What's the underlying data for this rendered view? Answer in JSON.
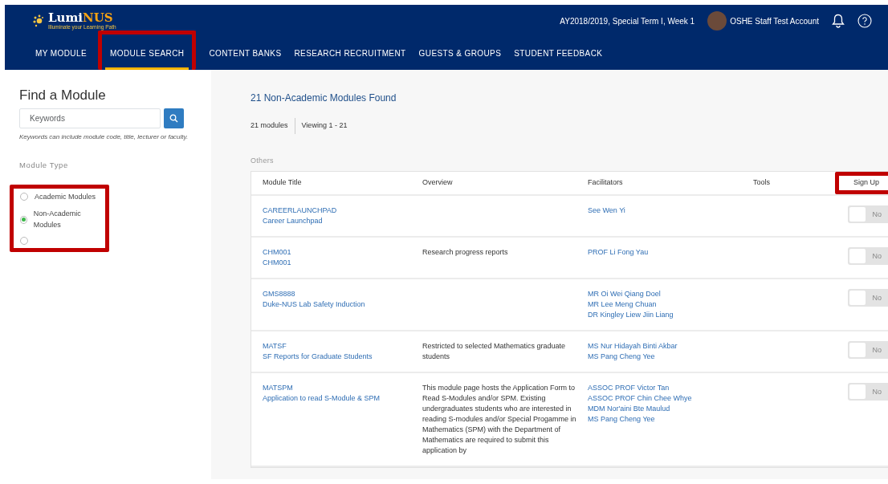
{
  "header": {
    "logo": "LumiNUS",
    "logo_tagline": "Illuminate your Learning Path",
    "term": "AY2018/2019, Special Term I, Week 1",
    "user": "OSHE Staff Test Account"
  },
  "nav": [
    {
      "label": "MY MODULE",
      "selected": false,
      "highlighted": false
    },
    {
      "label": "MODULE SEARCH",
      "selected": true,
      "highlighted": true
    },
    {
      "label": "CONTENT BANKS",
      "selected": false,
      "highlighted": false
    },
    {
      "label": "RESEARCH RECRUITMENT",
      "selected": false,
      "highlighted": false
    },
    {
      "label": "GUESTS & GROUPS",
      "selected": false,
      "highlighted": false
    },
    {
      "label": "STUDENT FEEDBACK",
      "selected": false,
      "highlighted": false
    }
  ],
  "sidebar": {
    "title": "Find a Module",
    "search": {
      "placeholder": "Keywords"
    },
    "hint": "Keywords can include module code, title, lecturer or faculty.",
    "filter_title": "Module Type",
    "filter_highlighted": true,
    "options": [
      {
        "label": "Academic Modules",
        "selected": false
      },
      {
        "label": "Non-Academic Modules",
        "selected": true
      },
      {
        "selected": false
      }
    ]
  },
  "results": {
    "title": "21 Non-Academic Modules Found",
    "count": "21 modules",
    "viewing": "Viewing 1 - 21",
    "group": "Others",
    "columns": [
      {
        "label": "Module Title",
        "highlighted": false
      },
      {
        "label": "Overview",
        "highlighted": false
      },
      {
        "label": "Facilitators",
        "highlighted": false
      },
      {
        "label": "Tools",
        "highlighted": false
      },
      {
        "label": "Sign Up",
        "highlighted": true
      }
    ],
    "rows": [
      {
        "code": "CAREERLAUNCHPAD",
        "title": "Career Launchpad",
        "overview": "",
        "facilitators": [
          "See Wen Yi"
        ],
        "signup": {
          "label": "No",
          "on": false
        }
      },
      {
        "code": "CHM001",
        "title": "CHM001",
        "overview": "Research progress reports",
        "facilitators": [
          "PROF Li Fong Yau"
        ],
        "signup": {
          "label": "No",
          "on": false
        }
      },
      {
        "code": "GMS8888",
        "title": "Duke-NUS Lab Safety Induction",
        "overview": "",
        "facilitators": [
          "MR Oi Wei Qiang Doel",
          "MR Lee Meng Chuan",
          "DR Kingley Liew Jiin Liang"
        ],
        "signup": {
          "label": "No",
          "on": false
        }
      },
      {
        "code": "MATSF",
        "title": "SF Reports for Graduate Students",
        "overview": "Restricted to selected Mathematics graduate students",
        "facilitators": [
          "MS Nur Hidayah Binti Akbar",
          "MS Pang Cheng Yee"
        ],
        "signup": {
          "label": "No",
          "on": false
        }
      },
      {
        "code": "MATSPM",
        "title": "Application to read S-Module & SPM",
        "overview": "This module page hosts the Application Form to Read S-Modules and/or SPM. Existing undergraduates students who are interested in reading S-modules and/or Special Progamme in Mathematics (SPM) with the Department of Mathematics are required to submit this application by",
        "facilitators": [
          "ASSOC PROF Victor Tan",
          "ASSOC PROF Chin Chee Whye",
          "MDM Nor'aini Bte Maulud",
          "MS Pang Cheng Yee"
        ],
        "signup": {
          "label": "No",
          "on": false
        }
      }
    ]
  }
}
